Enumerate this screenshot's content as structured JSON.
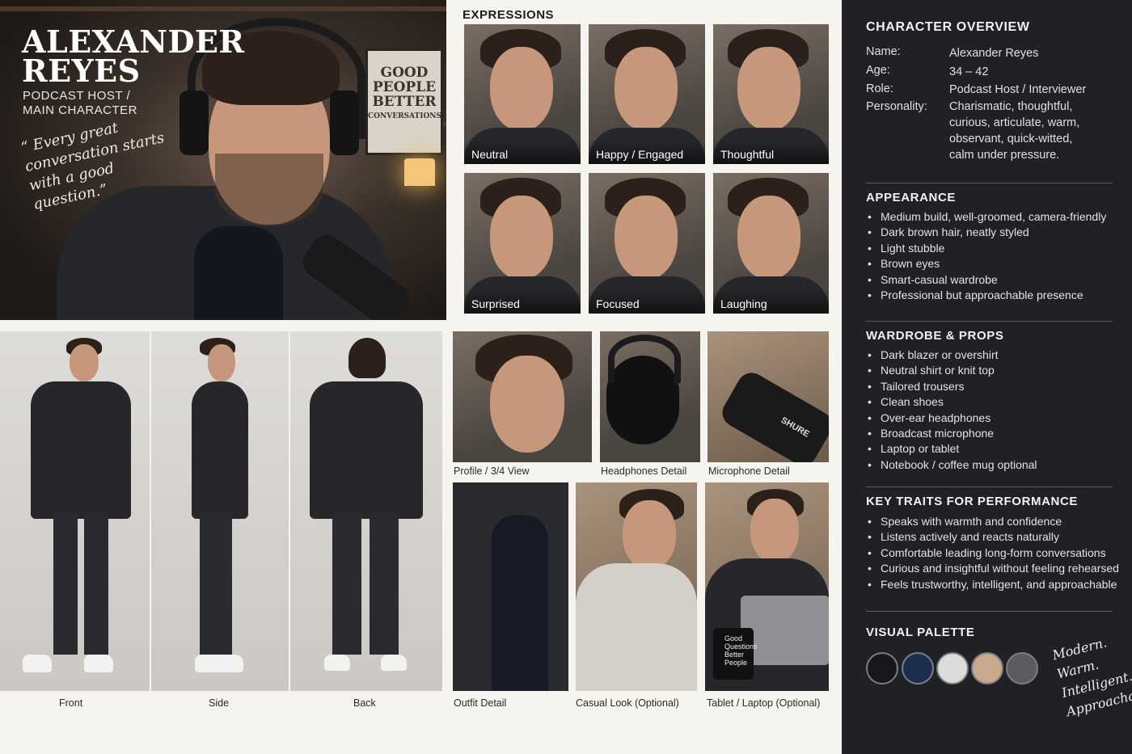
{
  "hero": {
    "name_line1": "ALEXANDER",
    "name_line2": "REYES",
    "role_line1": "PODCAST HOST /",
    "role_line2": "MAIN CHARACTER",
    "quote": "“ Every great conversation starts with a good question.”",
    "sign_line1": "GOOD",
    "sign_line2": "PEOPLE",
    "sign_line3": "BETTER",
    "sign_line4": "CONVERSATIONS"
  },
  "expressions": {
    "title": "EXPRESSIONS",
    "items": [
      {
        "label": "Neutral"
      },
      {
        "label": "Happy / Engaged"
      },
      {
        "label": "Thoughtful"
      },
      {
        "label": "Surprised"
      },
      {
        "label": "Focused"
      },
      {
        "label": "Laughing"
      }
    ]
  },
  "turnaround": {
    "views": [
      {
        "label": "Front"
      },
      {
        "label": "Side"
      },
      {
        "label": "Back"
      }
    ]
  },
  "details": {
    "row1": [
      {
        "label": "Profile / 3/4 View"
      },
      {
        "label": "Headphones Detail"
      },
      {
        "label": "Microphone Detail"
      }
    ],
    "row2": [
      {
        "label": "Outfit Detail"
      },
      {
        "label": "Casual Look (Optional)"
      },
      {
        "label": "Tablet / Laptop (Optional)"
      }
    ],
    "mic_brand": "SHURE",
    "mug_text": "Good Questions Better People"
  },
  "overview": {
    "title": "CHARACTER OVERVIEW",
    "rows": [
      {
        "key": "Name:",
        "value": "Alexander Reyes"
      },
      {
        "key": "Age:",
        "value": "34 – 42"
      },
      {
        "key": "Role:",
        "value": "Podcast Host / Interviewer"
      },
      {
        "key": "Personality:",
        "value": "Charismatic, thoughtful, curious, articulate, warm, observant, quick-witted, calm under pressure."
      }
    ]
  },
  "appearance": {
    "title": "APPEARANCE",
    "items": [
      "Medium build, well-groomed, camera-friendly",
      "Dark brown hair, neatly styled",
      "Light stubble",
      "Brown eyes",
      "Smart-casual wardrobe",
      "Professional but approachable presence"
    ]
  },
  "wardrobe": {
    "title": "WARDROBE & PROPS",
    "items": [
      "Dark blazer or overshirt",
      "Neutral shirt or knit top",
      "Tailored trousers",
      "Clean shoes",
      "Over-ear headphones",
      "Broadcast microphone",
      "Laptop or tablet",
      "Notebook / coffee mug optional"
    ]
  },
  "traits": {
    "title": "KEY TRAITS FOR PERFORMANCE",
    "items": [
      "Speaks with warmth and confidence",
      "Listens actively and reacts naturally",
      "Comfortable leading long-form conversations",
      "Curious and insightful without feeling rehearsed",
      "Feels trustworthy, intelligent, and approachable"
    ]
  },
  "palette": {
    "title": "VISUAL PALETTE",
    "colors": [
      "#17181b",
      "#1d2d4f",
      "#dcdcda",
      "#c9a88b",
      "#5a5c5f"
    ],
    "tagline": [
      "Modern.",
      "Warm.",
      "Intelligent.",
      "Approachable."
    ]
  }
}
